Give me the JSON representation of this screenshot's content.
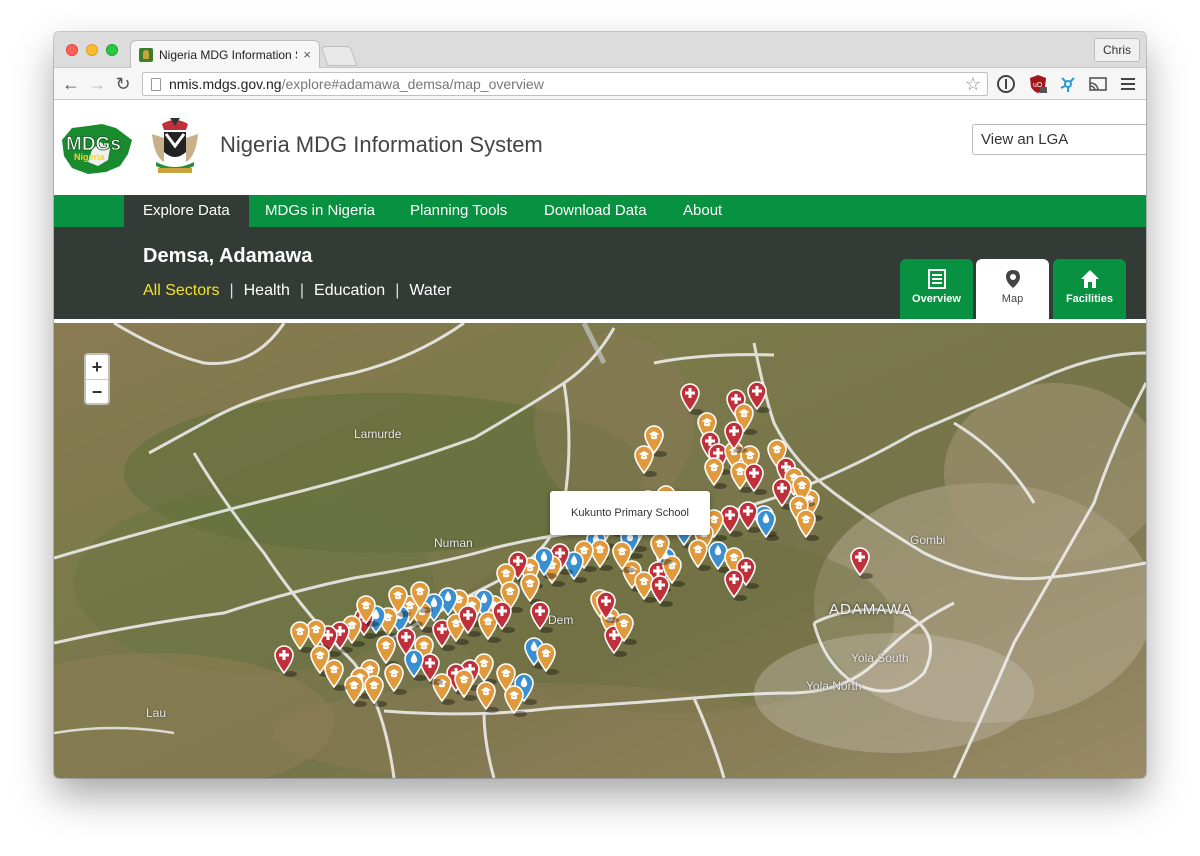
{
  "browser": {
    "tab_title": "Nigeria MDG Information S",
    "tab_close": "×",
    "url_host": "nmis.mdgs.gov.ng",
    "url_path": "/explore#adamawa_demsa/map_overview",
    "profile_name": "Chris"
  },
  "header": {
    "site_title": "Nigeria MDG Information System",
    "lga_placeholder": "View an LGA",
    "logo_text": "MDGs",
    "logo_subtext": "Nigeria"
  },
  "nav": {
    "items": [
      "Explore Data",
      "MDGs in Nigeria",
      "Planning Tools",
      "Download Data",
      "About"
    ],
    "active_index": 0
  },
  "location": {
    "title": "Demsa, Adamawa",
    "sectors": [
      "All Sectors",
      "Health",
      "Education",
      "Water"
    ],
    "active_sector": 0,
    "separator": "|"
  },
  "view_tabs": [
    {
      "label": "Overview",
      "icon": "list-icon",
      "active": false
    },
    {
      "label": "Map",
      "icon": "map-pin-icon",
      "active": true
    },
    {
      "label": "Facilities",
      "icon": "home-icon",
      "active": false
    }
  ],
  "map": {
    "zoom_in": "+",
    "zoom_out": "−",
    "popup_text": "Kukunto Primary School",
    "places": [
      "Lamurde",
      "Numan",
      "Gombi",
      "ADAMAWA",
      "Yola South",
      "Yola North",
      "Lau",
      "Dem"
    ],
    "marker_colors": {
      "health": "#c0303a",
      "education": "#e09a3c",
      "water": "#3a8fd0"
    }
  }
}
